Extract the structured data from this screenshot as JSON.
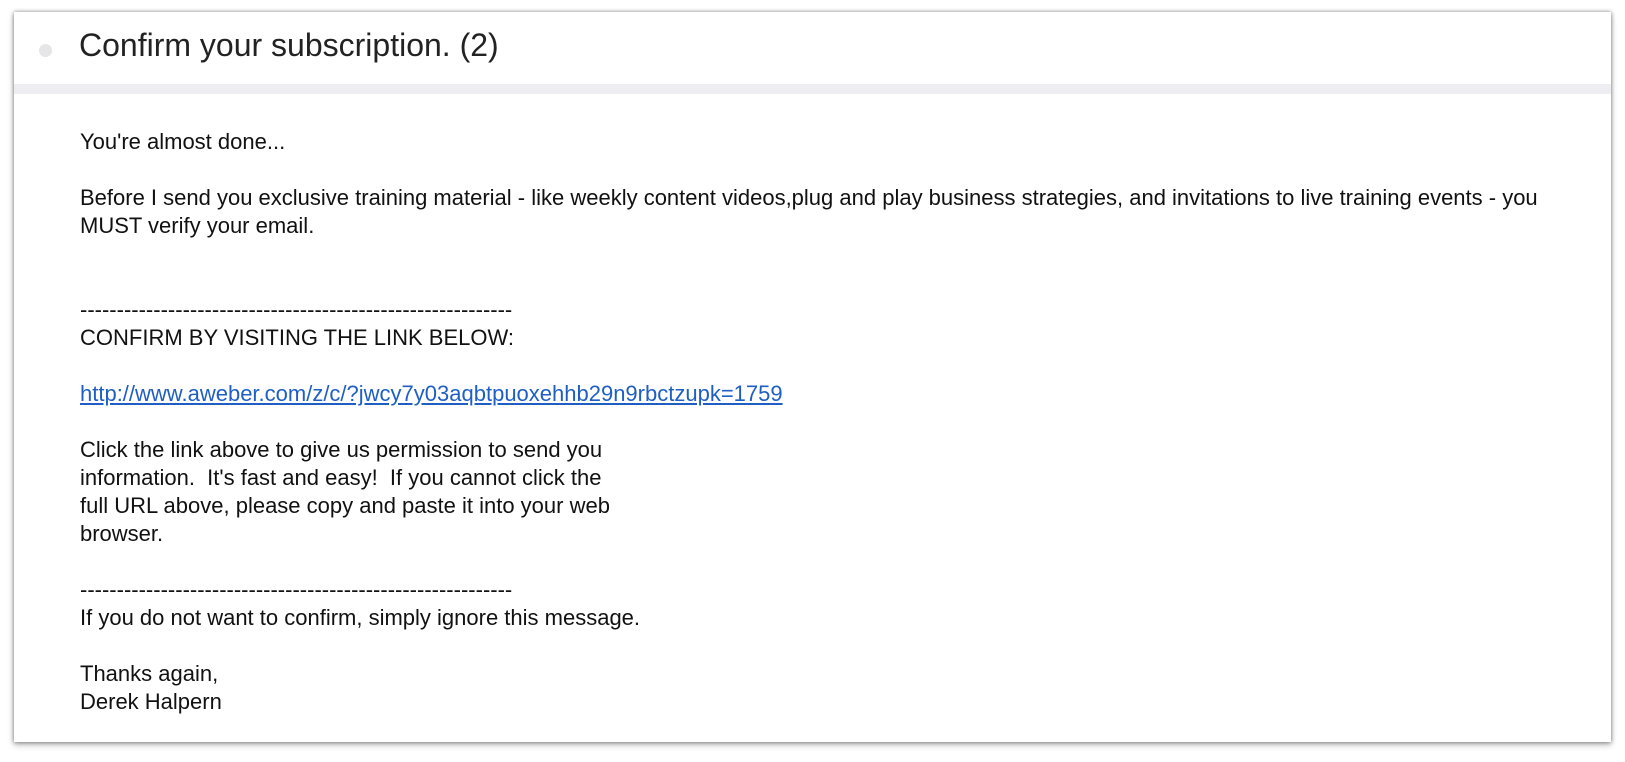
{
  "message": {
    "subject": "Confirm your subscription. (2)",
    "greeting": "You're almost done...",
    "intro": "Before I send you exclusive training material - like weekly content videos,plug and play business strategies, and invitations to live training events - you MUST verify your email.",
    "separator_1": "-----------------------------------------------------------",
    "confirm_heading": "CONFIRM BY VISITING THE LINK BELOW:",
    "confirm_link": "http://www.aweber.com/z/c/?jwcy7y03aqbtpuoxehhb29n9rbctzupk=1759",
    "instructions": [
      "Click the link above to give us permission to send you",
      "information.  It's fast and easy!  If you cannot click the",
      "full URL above, please copy and paste it into your web",
      "browser."
    ],
    "separator_2": "-----------------------------------------------------------",
    "ignore_note": "If you do not want to confirm, simply ignore this message.",
    "signoff": "Thanks again,",
    "signature": "Derek Halpern"
  },
  "colors": {
    "link": "#1f5fc4",
    "divider": "#eeeef2",
    "status_dot": "#e6e6e8"
  }
}
